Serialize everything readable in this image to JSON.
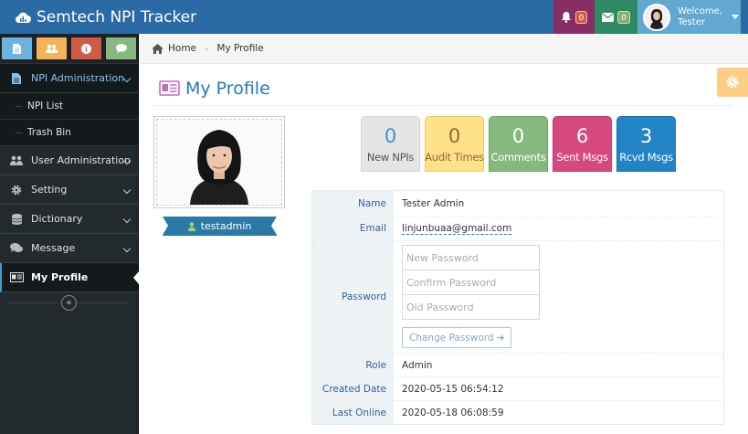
{
  "app": {
    "title": "Semtech NPI Tracker"
  },
  "navbar": {
    "alerts_count": "0",
    "messages_count": "0",
    "welcome_label": "Welcome,",
    "user_name": "Tester"
  },
  "sidebar": {
    "items": [
      {
        "label": "NPI Administration",
        "icon": "file-icon"
      },
      {
        "label": "User Administration",
        "icon": "users-icon"
      },
      {
        "label": "Setting",
        "icon": "gear-icon"
      },
      {
        "label": "Dictionary",
        "icon": "database-icon"
      },
      {
        "label": "Message",
        "icon": "comments-icon"
      },
      {
        "label": "My Profile",
        "icon": "profile-card-icon"
      }
    ],
    "sub_items": [
      "NPI List",
      "Trash Bin"
    ]
  },
  "breadcrumb": {
    "home": "Home",
    "current": "My Profile"
  },
  "page": {
    "title": "My Profile"
  },
  "profile": {
    "username": "testadmin"
  },
  "stats": [
    {
      "value": "0",
      "label": "New NPIs"
    },
    {
      "value": "0",
      "label": "Audit Times"
    },
    {
      "value": "0",
      "label": "Comments"
    },
    {
      "value": "6",
      "label": "Sent Msgs"
    },
    {
      "value": "3",
      "label": "Rcvd Msgs"
    }
  ],
  "info": {
    "name_label": "Name",
    "name": "Tester Admin",
    "email_label": "Email",
    "email": "linjunbuaa@gmail.com",
    "password_label": "Password",
    "new_password_placeholder": "New Password",
    "confirm_password_placeholder": "Confirm Password",
    "old_password_placeholder": "Old Password",
    "change_password_button": "Change Password",
    "role_label": "Role",
    "role": "Admin",
    "created_label": "Created Date",
    "created": "2020-05-15 06:54:12",
    "last_online_label": "Last Online",
    "last_online": "2020-05-18 06:08:59"
  },
  "colors": {
    "navbar": "#2b6aa5",
    "sidebar": "#222a2d",
    "accent": "#2679b5",
    "stat_gray": "#e5e5e5",
    "stat_yellow": "#fee188",
    "stat_green": "#87b87f",
    "stat_pink": "#d6487e",
    "stat_blue": "#2283c5"
  }
}
